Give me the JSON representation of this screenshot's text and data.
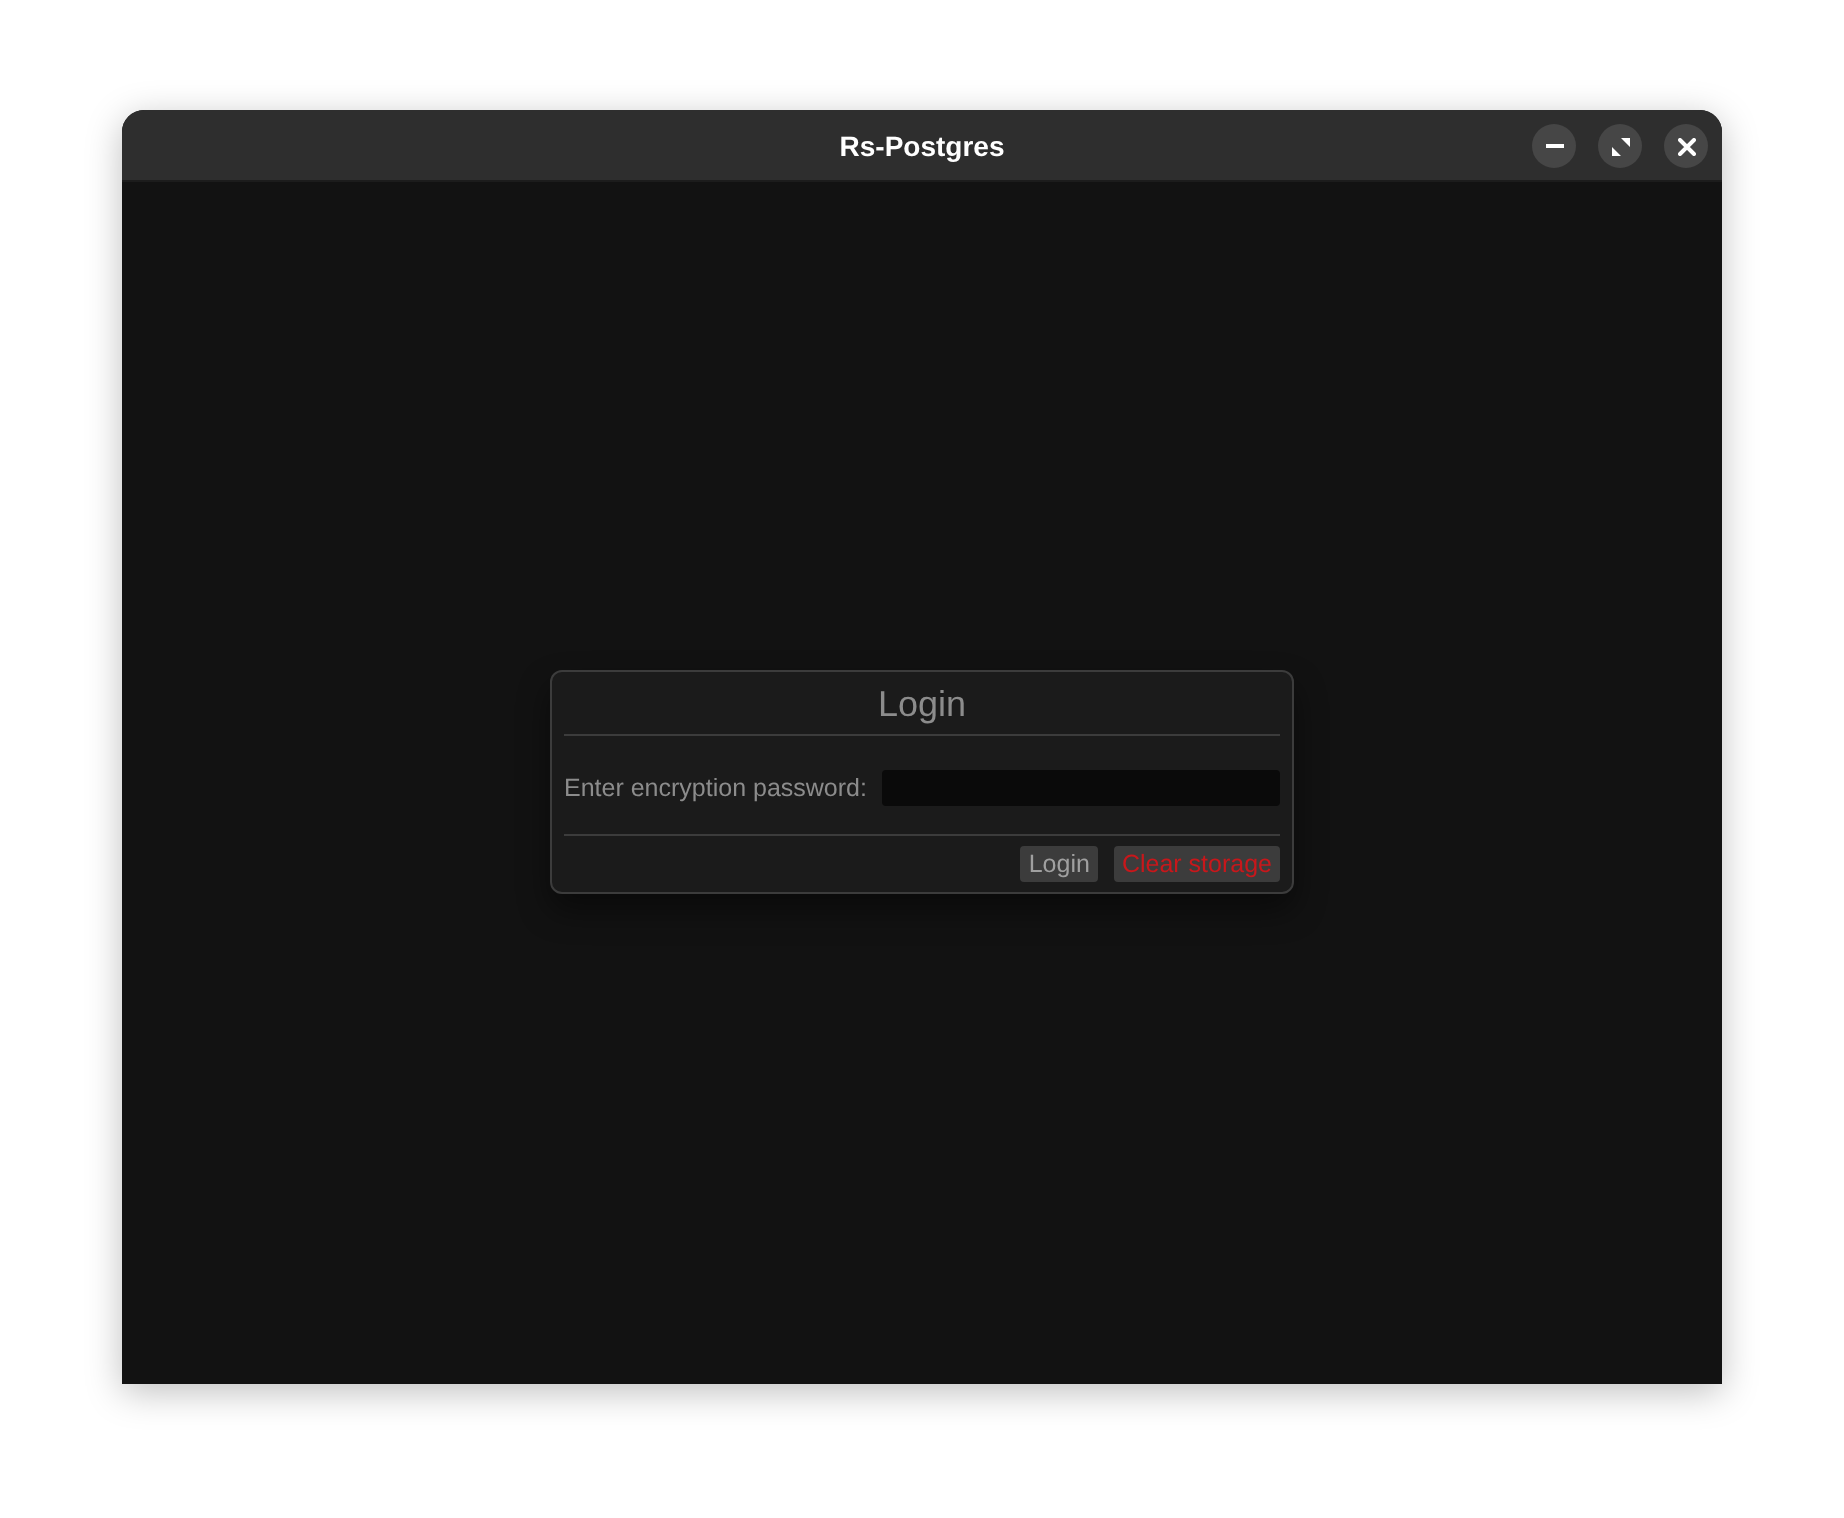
{
  "window": {
    "title": "Rs-Postgres"
  },
  "dialog": {
    "title": "Login",
    "password_field": {
      "label": "Enter encryption password:"
    },
    "buttons": [
      {
        "label": "Login",
        "kind": "normal"
      },
      {
        "label": "Clear storage",
        "kind": "danger"
      }
    ]
  }
}
